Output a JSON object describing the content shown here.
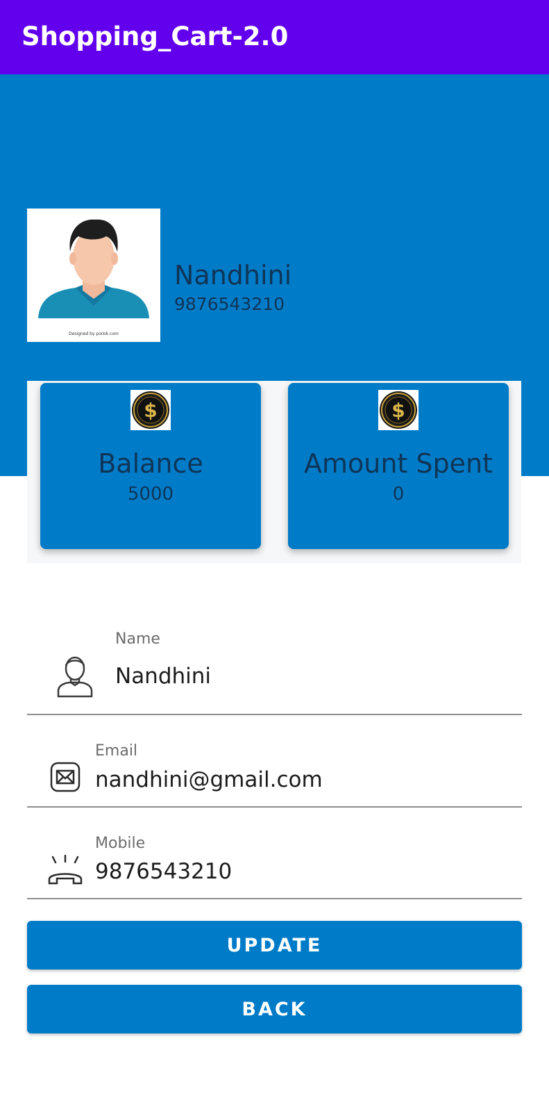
{
  "app_bar": {
    "title": "Shopping_Cart-2.0",
    "color": "#6200ee"
  },
  "profile": {
    "name": "Nandhini",
    "phone": "9876543210",
    "avatar_caption": "Designed by pixlok.com",
    "header_color": "#007bc8"
  },
  "cards": [
    {
      "icon": "dollar-coin-icon",
      "title": "Balance",
      "value": "5000"
    },
    {
      "icon": "dollar-coin-icon",
      "title": "Amount Spent",
      "value": "0"
    }
  ],
  "form": {
    "name": {
      "label": "Name",
      "value": "Nandhini",
      "icon": "user-icon"
    },
    "email": {
      "label": "Email",
      "value": "nandhini@gmail.com",
      "icon": "mail-icon"
    },
    "mobile": {
      "label": "Mobile",
      "value": "9876543210",
      "icon": "phone-ringing-icon"
    }
  },
  "buttons": {
    "update": "UPDATE",
    "back": "BACK"
  }
}
